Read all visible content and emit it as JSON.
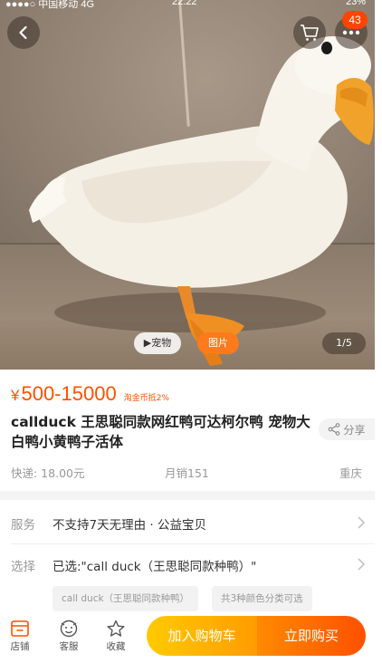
{
  "status_bar": {
    "carrier": "●●●●○ 中国移动  4G",
    "time": "22:22",
    "battery": "23%"
  },
  "header": {
    "cart_badge": "43",
    "icons": [
      "back-arrow-icon",
      "cart-icon",
      "more-icon"
    ]
  },
  "gallery": {
    "tag_pet": "▶宠物",
    "tag_picture": "图片",
    "counter": "1/5"
  },
  "product": {
    "price_symbol": "¥",
    "price": "500-15000",
    "coin_tag": "淘金币抵2%",
    "title": "callduck 王思聪同款网红鸭可达柯尔鸭 宠物大白鸭小黄鸭子活体",
    "share_label": "分享",
    "shipping": "快递: 18.00元",
    "monthly_sales": "月销151",
    "location": "重庆"
  },
  "options": {
    "service_label": "服务",
    "service_value": "不支持7天无理由 · 公益宝贝",
    "select_label": "选择",
    "select_value": "已选:\"call duck（王思聪同款种鸭）\"",
    "chips": [
      "call duck（王思聪同款种鸭）",
      "共3种颜色分类可选"
    ]
  },
  "bottom_bar": {
    "shop": "店铺",
    "customer_service": "客服",
    "favorite": "收藏",
    "add_to_cart": "加入购物车",
    "buy_now": "立即购买"
  },
  "colors": {
    "accent": "#ff5000",
    "cart_button": "#ffb000",
    "buy_button": "#ff6a00"
  }
}
